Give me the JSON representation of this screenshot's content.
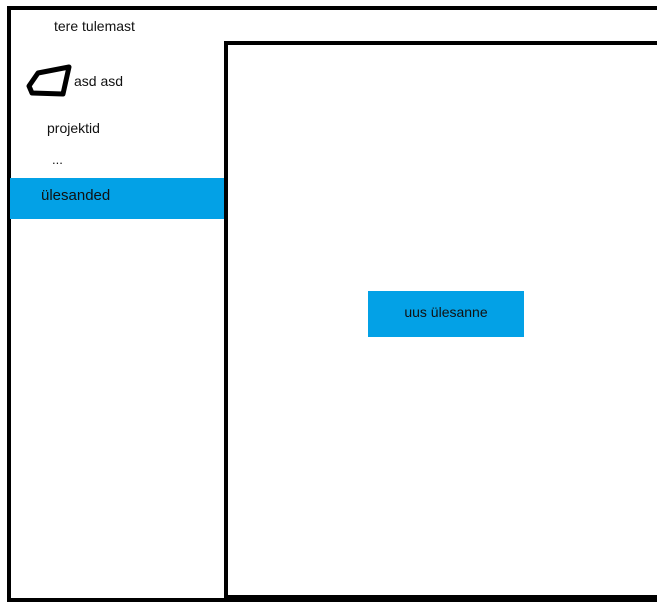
{
  "header": {
    "welcome_text": "tere tulemast"
  },
  "user": {
    "name": "asd asd",
    "avatar_icon": "user-avatar-icon"
  },
  "sidebar": {
    "items": [
      {
        "label": "projektid",
        "active": false
      },
      {
        "label": "...",
        "active": false
      },
      {
        "label": "ülesanded",
        "active": true
      }
    ],
    "active_color": "#03a1e6"
  },
  "main": {
    "new_task_label": "uus ülesanne",
    "button_color": "#03a1e6"
  }
}
